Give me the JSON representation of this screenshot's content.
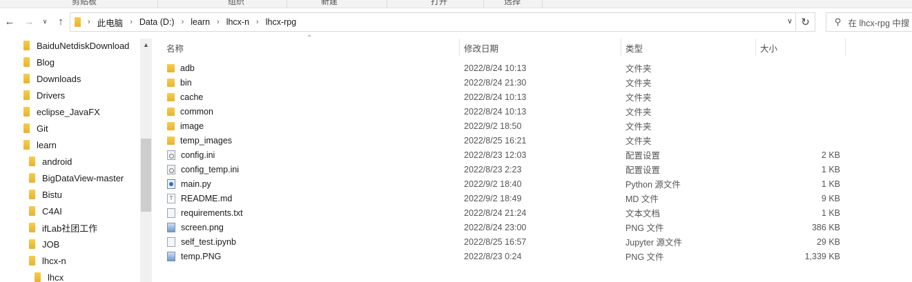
{
  "ribbon": {
    "groups": [
      "剪贴板",
      "组织",
      "新建",
      "打开",
      "选择"
    ]
  },
  "navigation": {
    "back_icon": "back-arrow-icon",
    "forward_icon": "forward-arrow-icon",
    "recent_icon": "chevron-down-icon",
    "up_icon": "up-arrow-icon",
    "breadcrumbs": [
      "此电脑",
      "Data (D:)",
      "learn",
      "lhcx-n",
      "lhcx-rpg"
    ],
    "search_placeholder": "在 lhcx-rpg 中搜"
  },
  "sidebar": {
    "items": [
      {
        "label": "BaiduNetdiskDownload",
        "level": 0
      },
      {
        "label": "Blog",
        "level": 0
      },
      {
        "label": "Downloads",
        "level": 0
      },
      {
        "label": "Drivers",
        "level": 0
      },
      {
        "label": "eclipse_JavaFX",
        "level": 0
      },
      {
        "label": "Git",
        "level": 0
      },
      {
        "label": "learn",
        "level": 0
      },
      {
        "label": "android",
        "level": 1
      },
      {
        "label": "BigDataView-master",
        "level": 1
      },
      {
        "label": "Bistu",
        "level": 1
      },
      {
        "label": "C4AI",
        "level": 1
      },
      {
        "label": "ifLab社团工作",
        "level": 1
      },
      {
        "label": "JOB",
        "level": 1
      },
      {
        "label": "lhcx-n",
        "level": 1
      },
      {
        "label": "lhcx",
        "level": 2
      }
    ]
  },
  "columns": {
    "name": "名称",
    "date": "修改日期",
    "type": "类型",
    "size": "大小"
  },
  "files": [
    {
      "name": "adb",
      "date": "2022/8/24 10:13",
      "type": "文件夹",
      "size": "",
      "icon": "folder"
    },
    {
      "name": "bin",
      "date": "2022/8/24 21:30",
      "type": "文件夹",
      "size": "",
      "icon": "folder"
    },
    {
      "name": "cache",
      "date": "2022/8/24 10:13",
      "type": "文件夹",
      "size": "",
      "icon": "folder"
    },
    {
      "name": "common",
      "date": "2022/8/24 10:13",
      "type": "文件夹",
      "size": "",
      "icon": "folder"
    },
    {
      "name": "image",
      "date": "2022/9/2 18:50",
      "type": "文件夹",
      "size": "",
      "icon": "folder"
    },
    {
      "name": "temp_images",
      "date": "2022/8/25 16:21",
      "type": "文件夹",
      "size": "",
      "icon": "folder"
    },
    {
      "name": "config.ini",
      "date": "2022/8/23 12:03",
      "type": "配置设置",
      "size": "2 KB",
      "icon": "ini"
    },
    {
      "name": "config_temp.ini",
      "date": "2022/8/23 2:23",
      "type": "配置设置",
      "size": "1 KB",
      "icon": "ini"
    },
    {
      "name": "main.py",
      "date": "2022/9/2 18:40",
      "type": "Python 源文件",
      "size": "1 KB",
      "icon": "py"
    },
    {
      "name": "README.md",
      "date": "2022/9/2 18:49",
      "type": "MD 文件",
      "size": "9 KB",
      "icon": "md"
    },
    {
      "name": "requirements.txt",
      "date": "2022/8/24 21:24",
      "type": "文本文档",
      "size": "1 KB",
      "icon": "doc"
    },
    {
      "name": "screen.png",
      "date": "2022/8/24 23:00",
      "type": "PNG 文件",
      "size": "386 KB",
      "icon": "img"
    },
    {
      "name": "self_test.ipynb",
      "date": "2022/8/25 16:57",
      "type": "Jupyter 源文件",
      "size": "29 KB",
      "icon": "doc"
    },
    {
      "name": "temp.PNG",
      "date": "2022/8/23 0:24",
      "type": "PNG 文件",
      "size": "1,339 KB",
      "icon": "img"
    }
  ]
}
